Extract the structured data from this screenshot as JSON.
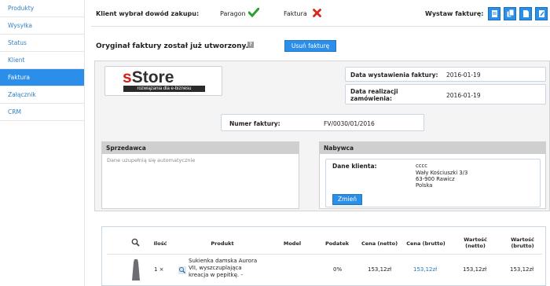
{
  "sidebar": {
    "items": [
      {
        "label": "Produkty"
      },
      {
        "label": "Wysyłka"
      },
      {
        "label": "Status"
      },
      {
        "label": "Klient"
      },
      {
        "label": "Faktura"
      },
      {
        "label": "Załącznik"
      },
      {
        "label": "CRM"
      }
    ]
  },
  "header": {
    "proof_label": "Klient wybrał dowód zakupu:",
    "paragon_label": "Paragon",
    "faktura_label": "Faktura",
    "issue_label": "Wystaw fakturę:",
    "original_text": "Oryginał faktury został już utworzony.",
    "help_icon_text": "?",
    "delete_button": "Usuń fakturę"
  },
  "invoice": {
    "logo_text_s": "s",
    "logo_text_store": "Store",
    "logo_tagline": "rozwiązania dla e-biznesu",
    "issue_date_label": "Data wystawienia faktury:",
    "issue_date": "2016-01-19",
    "realization_label_1": "Data realizacji",
    "realization_label_2": "zamówienia:",
    "realization_date": "2016-01-19",
    "number_label": "Numer faktury:",
    "number": "FV/0030/01/2016"
  },
  "seller": {
    "title": "Sprzedawca",
    "auto_text": "Dane uzupełnią się automatycznie"
  },
  "buyer": {
    "title": "Nabywca",
    "client_label": "Dane klienta:",
    "name": "cccc",
    "street": "Wały Kościuszki 3/3",
    "city": "63-900 Rawicz",
    "country": "Polska",
    "change_button": "Zmień"
  },
  "table": {
    "headers": {
      "qty": "Ilość",
      "product": "Produkt",
      "model": "Model",
      "tax": "Podatek",
      "net": "Cena (netto)",
      "gross": "Cena (brutto)",
      "value_net_1": "Wartość",
      "value_net_2": "(netto)",
      "value_gross_1": "Wartość",
      "value_gross_2": "(brutto)"
    },
    "rows": [
      {
        "qty": "1 ×",
        "product_line1": "Sukienka damska Aurora",
        "product_line2": "VII, wyszczuplająca",
        "product_line3": "kreacja w pepitkę. -",
        "model": "",
        "tax": "0%",
        "net": "153,12zł",
        "gross": "153,12zł",
        "value_net": "153,12zł",
        "value_gross": "153,12zł"
      }
    ]
  }
}
